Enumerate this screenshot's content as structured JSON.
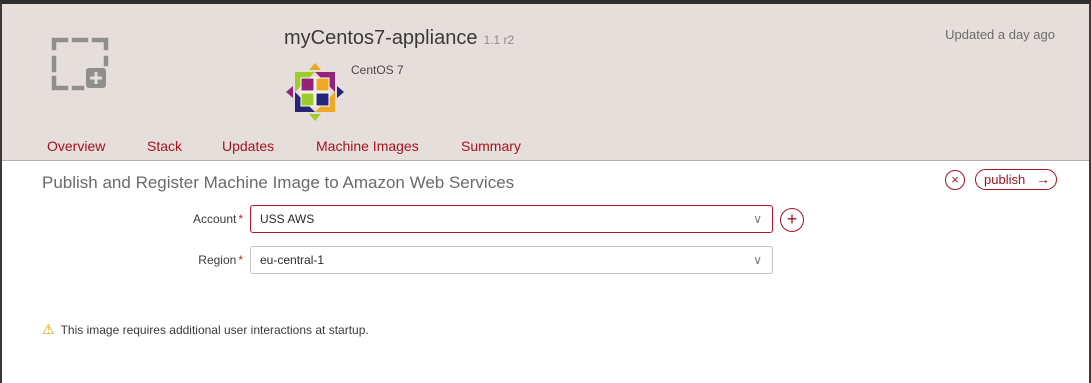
{
  "appliance": {
    "name": "myCentos7-appliance",
    "version": "1.1 r2",
    "updated": "Updated a day ago",
    "os_name": "CentOS 7",
    "icon": "placeholder-image-icon",
    "os_icon": "centos-logo-icon"
  },
  "tabs": [
    {
      "label": "Overview"
    },
    {
      "label": "Stack"
    },
    {
      "label": "Updates"
    },
    {
      "label": "Machine Images"
    },
    {
      "label": "Summary"
    }
  ],
  "form": {
    "title": "Publish and Register Machine Image to Amazon Web Services",
    "cancel_icon": "×",
    "publish_label": "publish",
    "publish_arrow": "→",
    "account": {
      "label": "Account",
      "required_mark": "*",
      "value": "USS AWS",
      "chevron": "∨",
      "add": "+"
    },
    "region": {
      "label": "Region",
      "required_mark": "*",
      "value": "eu-central-1",
      "chevron": "∨"
    }
  },
  "warning": {
    "icon": "⚠",
    "text": "This image requires additional user interactions at startup."
  },
  "colors": {
    "header_bg": "#e6dedb",
    "accent": "#a31420",
    "warning": "#e6a100"
  }
}
